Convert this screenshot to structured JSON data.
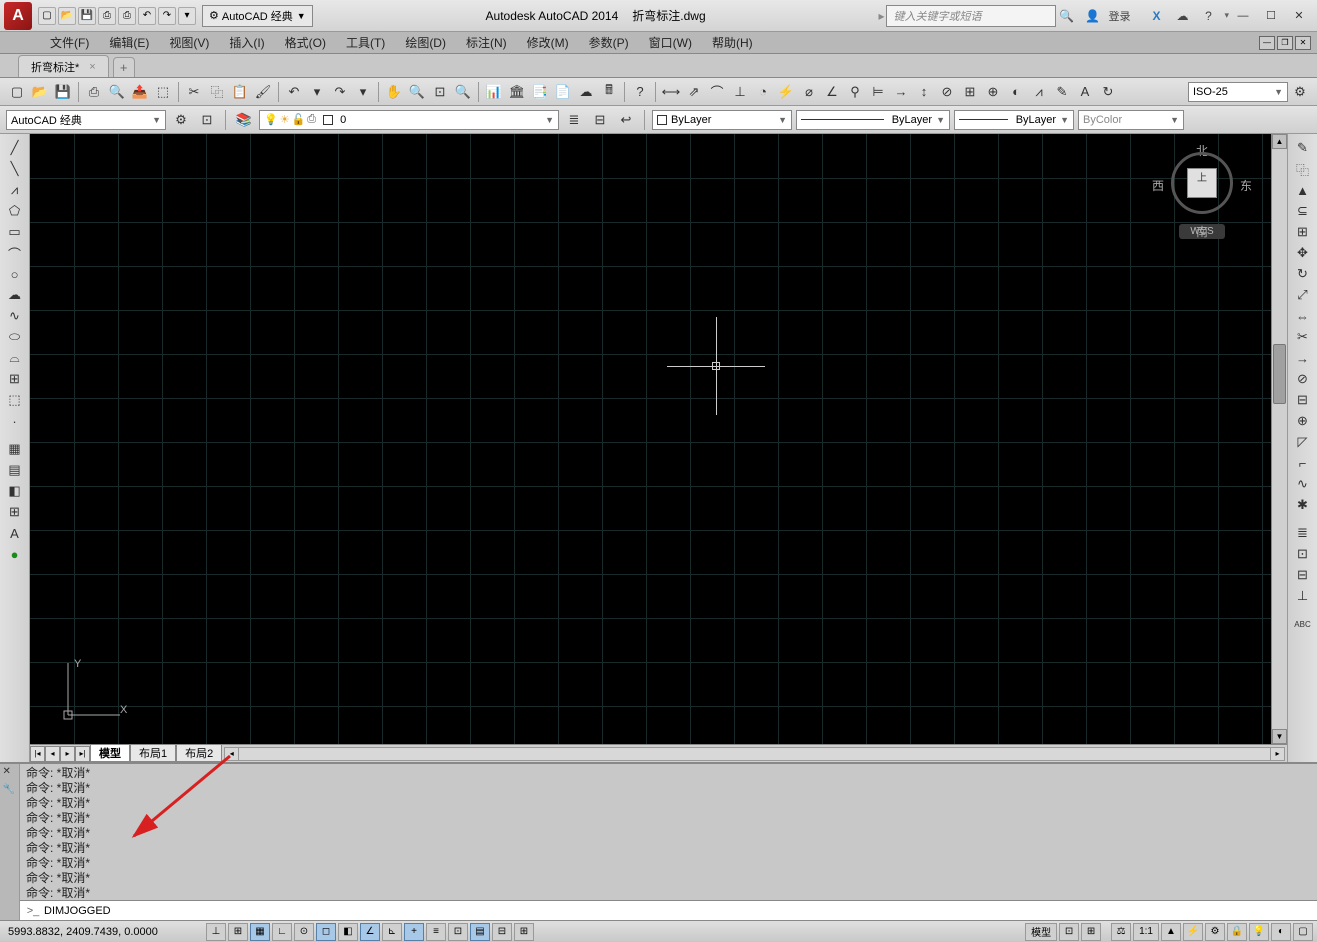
{
  "title": {
    "app": "Autodesk AutoCAD 2014",
    "file": "折弯标注.dwg",
    "search_placeholder": "键入关键字或短语",
    "login": "登录",
    "logo": "A"
  },
  "workspace_dd": "AutoCAD 经典",
  "menus": [
    "文件(F)",
    "编辑(E)",
    "视图(V)",
    "插入(I)",
    "格式(O)",
    "工具(T)",
    "绘图(D)",
    "标注(N)",
    "修改(M)",
    "参数(P)",
    "窗口(W)",
    "帮助(H)"
  ],
  "doctab": {
    "name": "折弯标注*",
    "close": "×"
  },
  "dim_style": "ISO-25",
  "props": {
    "workspace": "AutoCAD 经典",
    "layer_value": "0",
    "bylayer1": "ByLayer",
    "bylayer2": "ByLayer",
    "bylayer3": "ByLayer",
    "bycolor": "ByColor"
  },
  "viewcube": {
    "n": "北",
    "s": "南",
    "e": "东",
    "w": "西",
    "top": "上",
    "wcs": "WCS"
  },
  "ucs": {
    "x": "X",
    "y": "Y"
  },
  "layout_tabs": {
    "model": "模型",
    "l1": "布局1",
    "l2": "布局2"
  },
  "cmd_history": [
    "命令: *取消*",
    "命令: *取消*",
    "命令: *取消*",
    "命令: *取消*",
    "命令: *取消*",
    "命令: *取消*",
    "命令: *取消*",
    "命令: *取消*",
    "命令: *取消*"
  ],
  "cmd_input": "DIMJOGGED",
  "cmd_prompt": ">_",
  "status": {
    "coords": "5993.8832, 2409.7439, 0.0000",
    "model": "模型",
    "scale": "1:1"
  }
}
